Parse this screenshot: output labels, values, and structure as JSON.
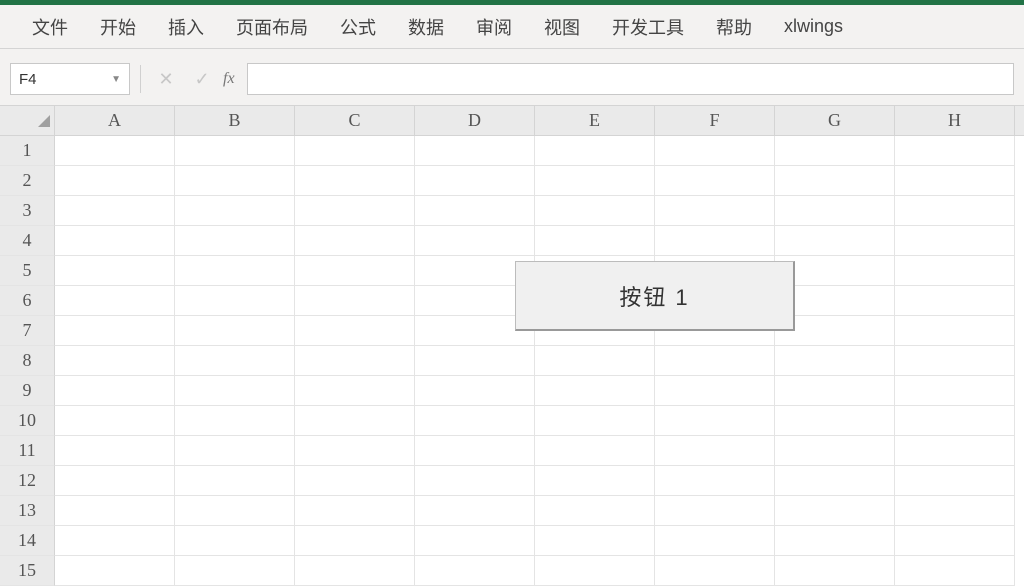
{
  "ribbon": {
    "tabs": [
      "文件",
      "开始",
      "插入",
      "页面布局",
      "公式",
      "数据",
      "审阅",
      "视图",
      "开发工具",
      "帮助",
      "xlwings"
    ]
  },
  "namebox": {
    "value": "F4"
  },
  "formula": {
    "value": "",
    "fx": "fx"
  },
  "columns": [
    "A",
    "B",
    "C",
    "D",
    "E",
    "F",
    "G",
    "H"
  ],
  "rows": [
    "1",
    "2",
    "3",
    "4",
    "5",
    "6",
    "7",
    "8",
    "9",
    "10",
    "11",
    "12",
    "13",
    "14",
    "15"
  ],
  "button": {
    "label": "按钮 1"
  }
}
